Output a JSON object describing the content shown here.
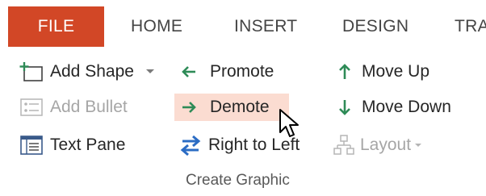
{
  "tabs": [
    {
      "label": "FILE"
    },
    {
      "label": "HOME"
    },
    {
      "label": "INSERT"
    },
    {
      "label": "DESIGN"
    },
    {
      "label": "TRA"
    }
  ],
  "commands": {
    "add_shape": "Add Shape",
    "add_bullet": "Add Bullet",
    "text_pane": "Text Pane",
    "promote": "Promote",
    "demote": "Demote",
    "right_to_left": "Right to Left",
    "move_up": "Move Up",
    "move_down": "Move Down",
    "layout": "Layout"
  },
  "group_label": "Create Graphic",
  "colors": {
    "file_tab": "#d24726",
    "hover_highlight": "#fbdcd1",
    "accent_green": "#2e8b57",
    "accent_blue": "#2b6cc4"
  },
  "icons": [
    "add-shape-icon",
    "dropdown-arrow-icon",
    "add-bullet-icon",
    "text-pane-icon",
    "promote-arrow-icon",
    "demote-arrow-icon",
    "right-to-left-icon",
    "move-up-icon",
    "move-down-icon",
    "layout-icon",
    "mouse-cursor-icon"
  ]
}
